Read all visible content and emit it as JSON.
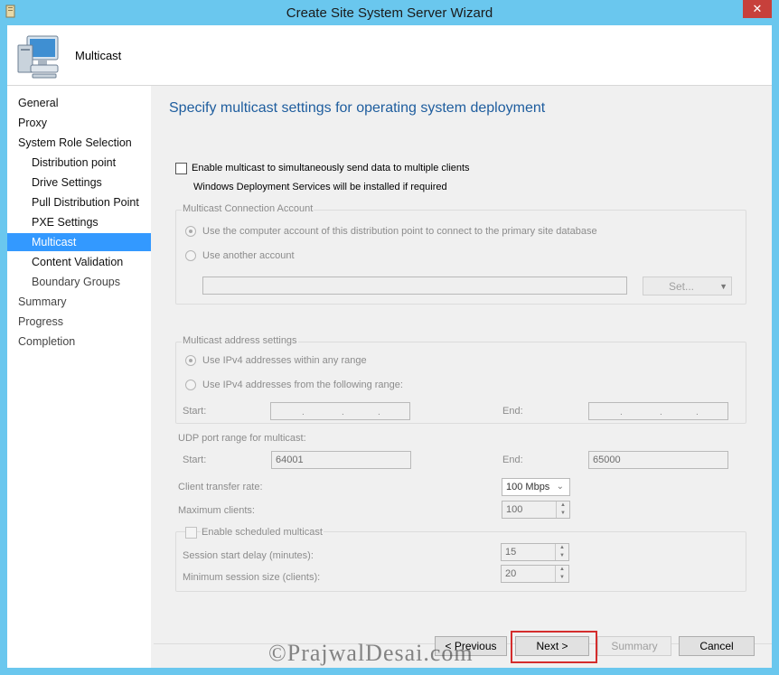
{
  "window": {
    "title": "Create Site System Server Wizard",
    "close_glyph": "✕"
  },
  "header": {
    "title": "Multicast"
  },
  "nav": {
    "items": [
      {
        "label": "General",
        "level": "top",
        "state": "normal"
      },
      {
        "label": "Proxy",
        "level": "top",
        "state": "normal"
      },
      {
        "label": "System Role Selection",
        "level": "top",
        "state": "normal"
      },
      {
        "label": "Distribution point",
        "level": "sub",
        "state": "normal"
      },
      {
        "label": "Drive Settings",
        "level": "sub",
        "state": "normal"
      },
      {
        "label": "Pull Distribution Point",
        "level": "sub",
        "state": "normal"
      },
      {
        "label": "PXE Settings",
        "level": "sub",
        "state": "normal"
      },
      {
        "label": "Multicast",
        "level": "sub",
        "state": "selected"
      },
      {
        "label": "Content Validation",
        "level": "sub",
        "state": "normal"
      },
      {
        "label": "Boundary Groups",
        "level": "sub",
        "state": "dim"
      },
      {
        "label": "Summary",
        "level": "top",
        "state": "dim"
      },
      {
        "label": "Progress",
        "level": "top",
        "state": "dim"
      },
      {
        "label": "Completion",
        "level": "top",
        "state": "dim"
      }
    ]
  },
  "main": {
    "page_title": "Specify multicast settings for operating system deployment",
    "enable_multicast_label": "Enable multicast to simultaneously send data to multiple clients",
    "enable_multicast_checked": false,
    "wds_note": "Windows Deployment Services will be installed if required",
    "connection_account": {
      "group_label": "Multicast Connection Account",
      "option_computer": "Use the computer account of this distribution point to connect to the primary site database",
      "option_another": "Use another account",
      "account_value": "",
      "set_button": "Set..."
    },
    "address_settings": {
      "group_label": "Multicast address settings",
      "option_any": "Use IPv4 addresses within any range",
      "option_range": "Use IPv4 addresses from the following range:",
      "start_label": "Start:",
      "end_label": "End:"
    },
    "udp": {
      "label": "UDP port range for multicast:",
      "start_label": "Start:",
      "start_value": "64001",
      "end_label": "End:",
      "end_value": "65000"
    },
    "transfer_rate": {
      "label": "Client transfer rate:",
      "value": "100 Mbps"
    },
    "max_clients": {
      "label": "Maximum clients:",
      "value": "100"
    },
    "scheduled": {
      "enable_label": "Enable scheduled multicast",
      "start_delay_label": "Session start delay (minutes):",
      "start_delay_value": "15",
      "min_size_label": "Minimum session size (clients):",
      "min_size_value": "20"
    }
  },
  "footer": {
    "previous": "< Previous",
    "next": "Next >",
    "summary": "Summary",
    "cancel": "Cancel"
  },
  "watermark": "©PrajwalDesai.com",
  "colors": {
    "title_blue": "#1e5d9e",
    "selected": "#3399ff",
    "frame": "#6ac7ee",
    "highlight": "#d42d2d"
  }
}
